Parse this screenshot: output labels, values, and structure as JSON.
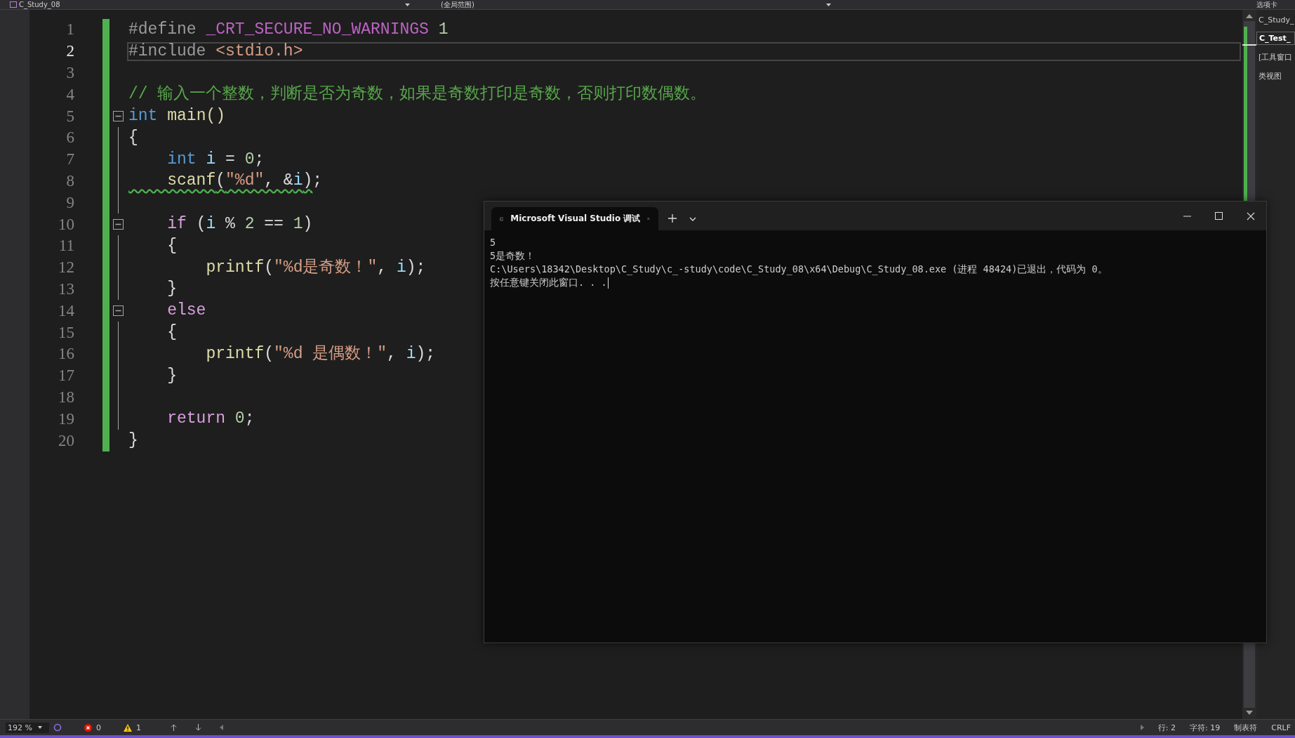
{
  "top_bar": {
    "project": "C_Study_08",
    "scope": "(全局范围)"
  },
  "editor": {
    "lines": [
      {
        "number": "1",
        "current": false,
        "fold": false,
        "tokens": [
          {
            "t": "#define ",
            "kind": "pre"
          },
          {
            "t": "_CRT_SECURE_NO_WARNINGS",
            "kind": "macro"
          },
          {
            "t": " 1",
            "kind": "num"
          }
        ]
      },
      {
        "number": "2",
        "current": true,
        "fold": false,
        "tokens": [
          {
            "t": "#include ",
            "kind": "pre"
          },
          {
            "t": "<stdio.h>",
            "kind": "str"
          }
        ]
      },
      {
        "number": "3",
        "current": false,
        "fold": false
      },
      {
        "number": "4",
        "current": false,
        "fold": false,
        "tokens": [
          {
            "t": "// 输入一个整数，判断是否为奇数，如果是奇数打印是奇数，否则打印数偶数。",
            "kind": "comment"
          }
        ]
      },
      {
        "number": "5",
        "current": false,
        "fold": true,
        "tokens": [
          {
            "t": "int",
            "kind": "kw"
          },
          {
            "t": " main()",
            "kind": "fn"
          }
        ]
      },
      {
        "number": "6",
        "current": false,
        "fold": false,
        "tokens": [
          {
            "t": "{",
            "kind": "punc"
          }
        ]
      },
      {
        "number": "7",
        "current": false,
        "fold": false,
        "tokens": [
          {
            "t": "    int",
            "kind": "kw"
          },
          {
            "t": " i",
            "kind": "var"
          },
          {
            "t": " = ",
            "kind": "punc"
          },
          {
            "t": "0",
            "kind": "num"
          },
          {
            "t": ";",
            "kind": "punc"
          }
        ]
      },
      {
        "number": "8",
        "current": false,
        "fold": false,
        "tokens": [
          {
            "t": "    scanf",
            "kind": "fn",
            "warning": true
          },
          {
            "t": "(",
            "kind": "punc",
            "warning": true
          },
          {
            "t": "\"%d\"",
            "kind": "str",
            "warning": true
          },
          {
            "t": ", &",
            "kind": "punc",
            "warning": true
          },
          {
            "t": "i",
            "kind": "var",
            "warning": true
          },
          {
            "t": ")",
            "kind": "punc",
            "warning": true
          },
          {
            "t": ";",
            "kind": "punc",
            "warning": false
          }
        ]
      },
      {
        "number": "9",
        "current": false,
        "fold": false
      },
      {
        "number": "10",
        "current": false,
        "fold": true,
        "tokens": [
          {
            "t": "    if",
            "kind": "ctl"
          },
          {
            "t": " (",
            "kind": "punc"
          },
          {
            "t": "i",
            "kind": "var"
          },
          {
            "t": " % ",
            "kind": "punc"
          },
          {
            "t": "2",
            "kind": "num"
          },
          {
            "t": " == ",
            "kind": "punc"
          },
          {
            "t": "1",
            "kind": "num"
          },
          {
            "t": ")",
            "kind": "punc"
          }
        ]
      },
      {
        "number": "11",
        "current": false,
        "fold": false,
        "tokens": [
          {
            "t": "    {",
            "kind": "punc"
          }
        ]
      },
      {
        "number": "12",
        "current": false,
        "fold": false,
        "tokens": [
          {
            "t": "        printf",
            "kind": "fn"
          },
          {
            "t": "(",
            "kind": "punc"
          },
          {
            "t": "\"%d是奇数！\"",
            "kind": "str"
          },
          {
            "t": ", ",
            "kind": "punc"
          },
          {
            "t": "i",
            "kind": "var"
          },
          {
            "t": ");",
            "kind": "punc"
          }
        ]
      },
      {
        "number": "13",
        "current": false,
        "fold": false,
        "tokens": [
          {
            "t": "    }",
            "kind": "punc"
          }
        ]
      },
      {
        "number": "14",
        "current": false,
        "fold": true,
        "tokens": [
          {
            "t": "    else",
            "kind": "ctl"
          }
        ]
      },
      {
        "number": "15",
        "current": false,
        "fold": false,
        "tokens": [
          {
            "t": "    {",
            "kind": "punc"
          }
        ]
      },
      {
        "number": "16",
        "current": false,
        "fold": false,
        "tokens": [
          {
            "t": "        printf",
            "kind": "fn"
          },
          {
            "t": "(",
            "kind": "punc"
          },
          {
            "t": "\"%d 是偶数！\"",
            "kind": "str"
          },
          {
            "t": ", ",
            "kind": "punc"
          },
          {
            "t": "i",
            "kind": "var"
          },
          {
            "t": ");",
            "kind": "punc"
          }
        ]
      },
      {
        "number": "17",
        "current": false,
        "fold": false,
        "tokens": [
          {
            "t": "    }",
            "kind": "punc"
          }
        ]
      },
      {
        "number": "18",
        "current": false,
        "fold": false
      },
      {
        "number": "19",
        "current": false,
        "fold": false,
        "tokens": [
          {
            "t": "    return",
            "kind": "ctl"
          },
          {
            "t": " 0",
            "kind": "num"
          },
          {
            "t": ";",
            "kind": "punc"
          }
        ]
      },
      {
        "number": "20",
        "current": false,
        "fold": false,
        "tokens": [
          {
            "t": "}",
            "kind": "punc"
          }
        ]
      }
    ]
  },
  "side_panel": {
    "header": "选项卡",
    "items": [
      {
        "label": "C_Study_",
        "selected": false
      },
      {
        "label": "C_Test_",
        "selected": true
      },
      {
        "label": "[工具窗口",
        "selected": false
      },
      {
        "label": "类视图",
        "selected": false
      }
    ]
  },
  "terminal": {
    "tab_title": "Microsoft Visual Studio 调试",
    "output": [
      "5",
      "5是奇数！",
      "C:\\Users\\18342\\Desktop\\C_Study\\c_-study\\code\\C_Study_08\\x64\\Debug\\C_Study_08.exe (进程 48424)已退出，代码为 0。",
      "按任意键关闭此窗口. . ."
    ]
  },
  "status_bar": {
    "zoom": "192 %",
    "errors": "0",
    "warnings": "1",
    "line": "行: 2",
    "char": "字符: 19",
    "indent": "制表符",
    "eol": "CRLF"
  }
}
